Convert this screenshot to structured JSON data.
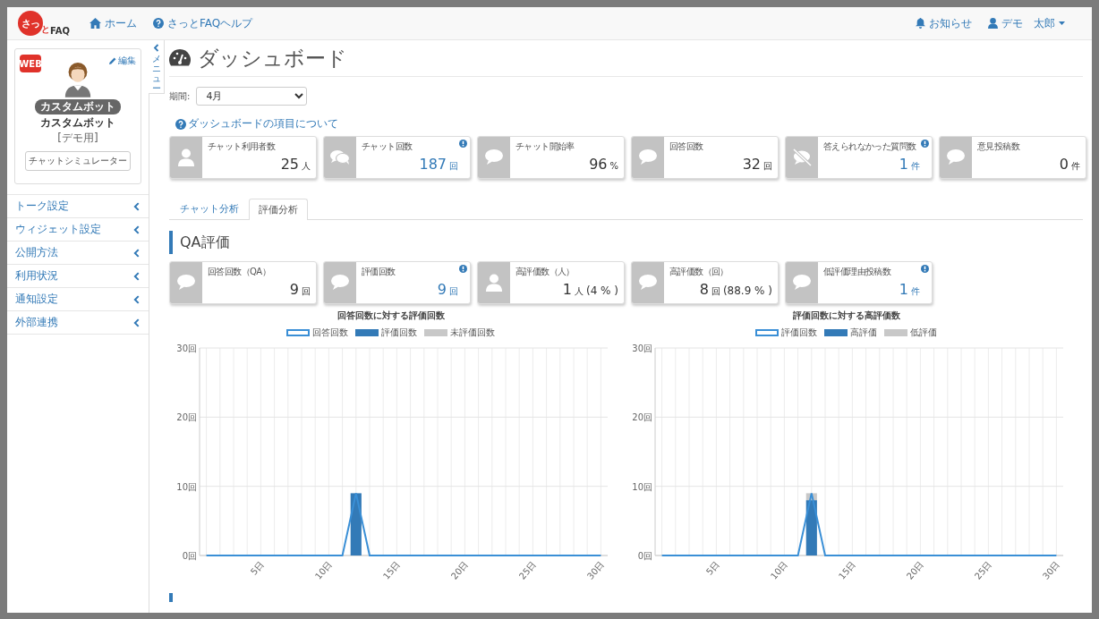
{
  "nav": {
    "logo_main": "さっ",
    "logo_small": "と",
    "logo_faq": "FAQ",
    "links": [
      {
        "kind": "home",
        "label": "ホーム"
      },
      {
        "kind": "help",
        "label": "さっとFAQヘルプ"
      }
    ],
    "right": [
      {
        "kind": "bell",
        "label": "お知らせ",
        "dropdown": false
      },
      {
        "kind": "user",
        "label": "デモ　太郎",
        "dropdown": true
      }
    ]
  },
  "profile": {
    "badge": "WEB",
    "edit": "編集",
    "tag": "カスタムボット",
    "name": "カスタムボット",
    "note": "[デモ用]",
    "button": "チャットシミュレーター"
  },
  "menu_toggle": {
    "label": "メニュー"
  },
  "sidebar": {
    "items": [
      {
        "label": "トーク設定"
      },
      {
        "label": "ウィジェット設定"
      },
      {
        "label": "公開方法"
      },
      {
        "label": "利用状況"
      },
      {
        "label": "通知設定"
      },
      {
        "label": "外部連携"
      }
    ]
  },
  "page": {
    "title": "ダッシュボード",
    "period_label": "期間:",
    "period_value": "4月",
    "help_link": "ダッシュボードの項目について"
  },
  "stats": [
    {
      "kind": "user",
      "label": "チャット利用者数",
      "value": "25",
      "unit": "人",
      "info": false
    },
    {
      "kind": "chats",
      "label": "チャット回数",
      "value": "187",
      "unit": "回",
      "info": true
    },
    {
      "kind": "bubble",
      "label": "チャット開始率",
      "value": "96",
      "unit": "%",
      "info": false
    },
    {
      "kind": "bubble",
      "label": "回答回数",
      "value": "32",
      "unit": "回",
      "info": false
    },
    {
      "kind": "bubble-off",
      "label": "答えられなかった質問数",
      "value": "1",
      "unit": "件",
      "info": true
    },
    {
      "kind": "bubble",
      "label": "意見投稿数",
      "value": "0",
      "unit": "件",
      "info": false
    }
  ],
  "tabs": [
    {
      "label": "チャット分析",
      "selected": false
    },
    {
      "label": "評価分析",
      "selected": true
    }
  ],
  "section_title": "QA評価",
  "qa_stats": [
    {
      "kind": "bubble",
      "label": "回答回数（QA）",
      "value": "9",
      "unit": "回",
      "info": false
    },
    {
      "kind": "bubble",
      "label": "評価回数",
      "value": "9",
      "unit": "回",
      "info": true
    },
    {
      "kind": "user",
      "label": "高評価数（人）",
      "value": "1",
      "unit": "人",
      "extra": "(4 % )",
      "info": false
    },
    {
      "kind": "bubble",
      "label": "高評価数（回）",
      "value": "8",
      "unit": "回",
      "extra": "(88.9 % )",
      "info": false
    },
    {
      "kind": "bubble",
      "label": "低評価理由投稿数",
      "value": "1",
      "unit": "件",
      "info": true
    }
  ],
  "charts": [
    {
      "chart_data": {
        "type": "bar",
        "title": "回答回数に対する評価回数",
        "stacked": true,
        "grid": true,
        "x": [
          1,
          2,
          3,
          4,
          5,
          6,
          7,
          8,
          9,
          10,
          11,
          12,
          13,
          14,
          15,
          16,
          17,
          18,
          19,
          20,
          21,
          22,
          23,
          24,
          25,
          26,
          27,
          28,
          29,
          30
        ],
        "series": [
          {
            "name": "回答回数",
            "color": "#3a8fd6",
            "type": "line",
            "values": [
              0,
              0,
              0,
              0,
              0,
              0,
              0,
              0,
              0,
              0,
              0,
              9,
              0,
              0,
              0,
              0,
              0,
              0,
              0,
              0,
              0,
              0,
              0,
              0,
              0,
              0,
              0,
              0,
              0,
              0
            ]
          },
          {
            "name": "評価回数",
            "color": "#337ab7",
            "type": "bar",
            "values": [
              0,
              0,
              0,
              0,
              0,
              0,
              0,
              0,
              0,
              0,
              0,
              9,
              0,
              0,
              0,
              0,
              0,
              0,
              0,
              0,
              0,
              0,
              0,
              0,
              0,
              0,
              0,
              0,
              0,
              0
            ]
          },
          {
            "name": "未評価回数",
            "color": "#c8c8c8",
            "type": "bar",
            "values": [
              0,
              0,
              0,
              0,
              0,
              0,
              0,
              0,
              0,
              0,
              0,
              0,
              0,
              0,
              0,
              0,
              0,
              0,
              0,
              0,
              0,
              0,
              0,
              0,
              0,
              0,
              0,
              0,
              0,
              0
            ]
          }
        ],
        "xlim": [
          0.5,
          30.5
        ],
        "ylim": [
          0,
          30
        ],
        "yticks": [
          {
            "value": 0,
            "label": "0回"
          },
          {
            "value": 10,
            "label": "10回"
          },
          {
            "value": 20,
            "label": "20回"
          },
          {
            "value": 30,
            "label": "30回"
          }
        ],
        "xticks": [
          {
            "value": 5,
            "label": "5日"
          },
          {
            "value": 10,
            "label": "10日"
          },
          {
            "value": 15,
            "label": "15日"
          },
          {
            "value": 20,
            "label": "20日"
          },
          {
            "value": 25,
            "label": "25日"
          },
          {
            "value": 30,
            "label": "30日"
          }
        ]
      }
    },
    {
      "chart_data": {
        "type": "bar",
        "title": "評価回数に対する高評価数",
        "stacked": true,
        "grid": true,
        "x": [
          1,
          2,
          3,
          4,
          5,
          6,
          7,
          8,
          9,
          10,
          11,
          12,
          13,
          14,
          15,
          16,
          17,
          18,
          19,
          20,
          21,
          22,
          23,
          24,
          25,
          26,
          27,
          28,
          29,
          30
        ],
        "series": [
          {
            "name": "評価回数",
            "color": "#3a8fd6",
            "type": "line",
            "values": [
              0,
              0,
              0,
              0,
              0,
              0,
              0,
              0,
              0,
              0,
              0,
              9,
              0,
              0,
              0,
              0,
              0,
              0,
              0,
              0,
              0,
              0,
              0,
              0,
              0,
              0,
              0,
              0,
              0,
              0
            ]
          },
          {
            "name": "高評価",
            "color": "#337ab7",
            "type": "bar",
            "values": [
              0,
              0,
              0,
              0,
              0,
              0,
              0,
              0,
              0,
              0,
              0,
              8,
              0,
              0,
              0,
              0,
              0,
              0,
              0,
              0,
              0,
              0,
              0,
              0,
              0,
              0,
              0,
              0,
              0,
              0
            ]
          },
          {
            "name": "低評価",
            "color": "#c8c8c8",
            "type": "bar",
            "values": [
              0,
              0,
              0,
              0,
              0,
              0,
              0,
              0,
              0,
              0,
              0,
              1,
              0,
              0,
              0,
              0,
              0,
              0,
              0,
              0,
              0,
              0,
              0,
              0,
              0,
              0,
              0,
              0,
              0,
              0
            ]
          }
        ],
        "xlim": [
          0.5,
          30.5
        ],
        "ylim": [
          0,
          30
        ],
        "yticks": [
          {
            "value": 0,
            "label": "0回"
          },
          {
            "value": 10,
            "label": "10回"
          },
          {
            "value": 20,
            "label": "20回"
          },
          {
            "value": 30,
            "label": "30回"
          }
        ],
        "xticks": [
          {
            "value": 5,
            "label": "5日"
          },
          {
            "value": 10,
            "label": "10日"
          },
          {
            "value": 15,
            "label": "15日"
          },
          {
            "value": 20,
            "label": "20日"
          },
          {
            "value": 25,
            "label": "25日"
          },
          {
            "value": 30,
            "label": "30日"
          }
        ]
      }
    }
  ]
}
